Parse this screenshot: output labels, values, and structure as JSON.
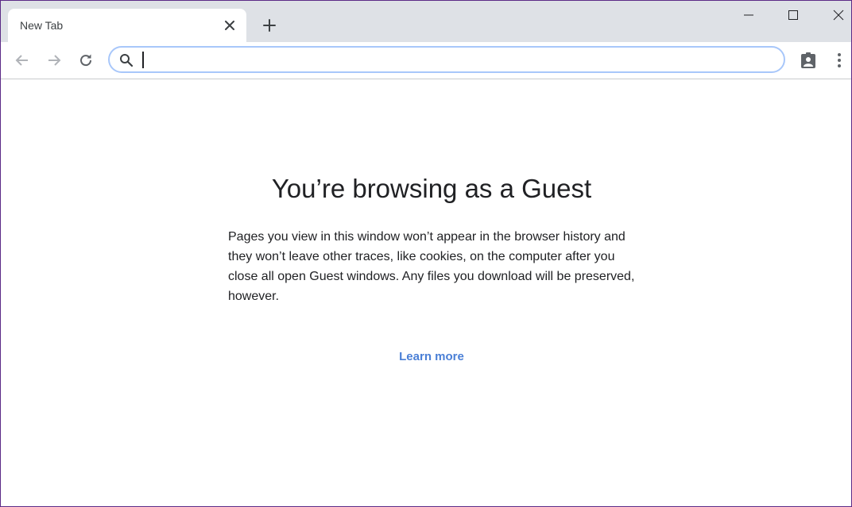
{
  "tab": {
    "title": "New Tab"
  },
  "toolbar": {
    "address_value": "",
    "icons": [
      "back-icon",
      "forward-icon",
      "reload-icon",
      "search-icon",
      "guest-profile-icon",
      "menu-icon"
    ]
  },
  "window_controls": [
    "minimize-icon",
    "maximize-icon",
    "close-icon"
  ],
  "content": {
    "heading": "You’re browsing as a Guest",
    "body": "Pages you view in this window won’t appear in the browser history and they won’t leave other traces, like cookies, on the computer after you close all open Guest windows. Any files you download will be preserved, however.",
    "learn_more": "Learn more"
  },
  "colors": {
    "tabstrip": "#dee1e6",
    "omnibox_focus": "#a8c7fa",
    "link": "#4a7fd6",
    "window_border": "#5b2a86"
  }
}
